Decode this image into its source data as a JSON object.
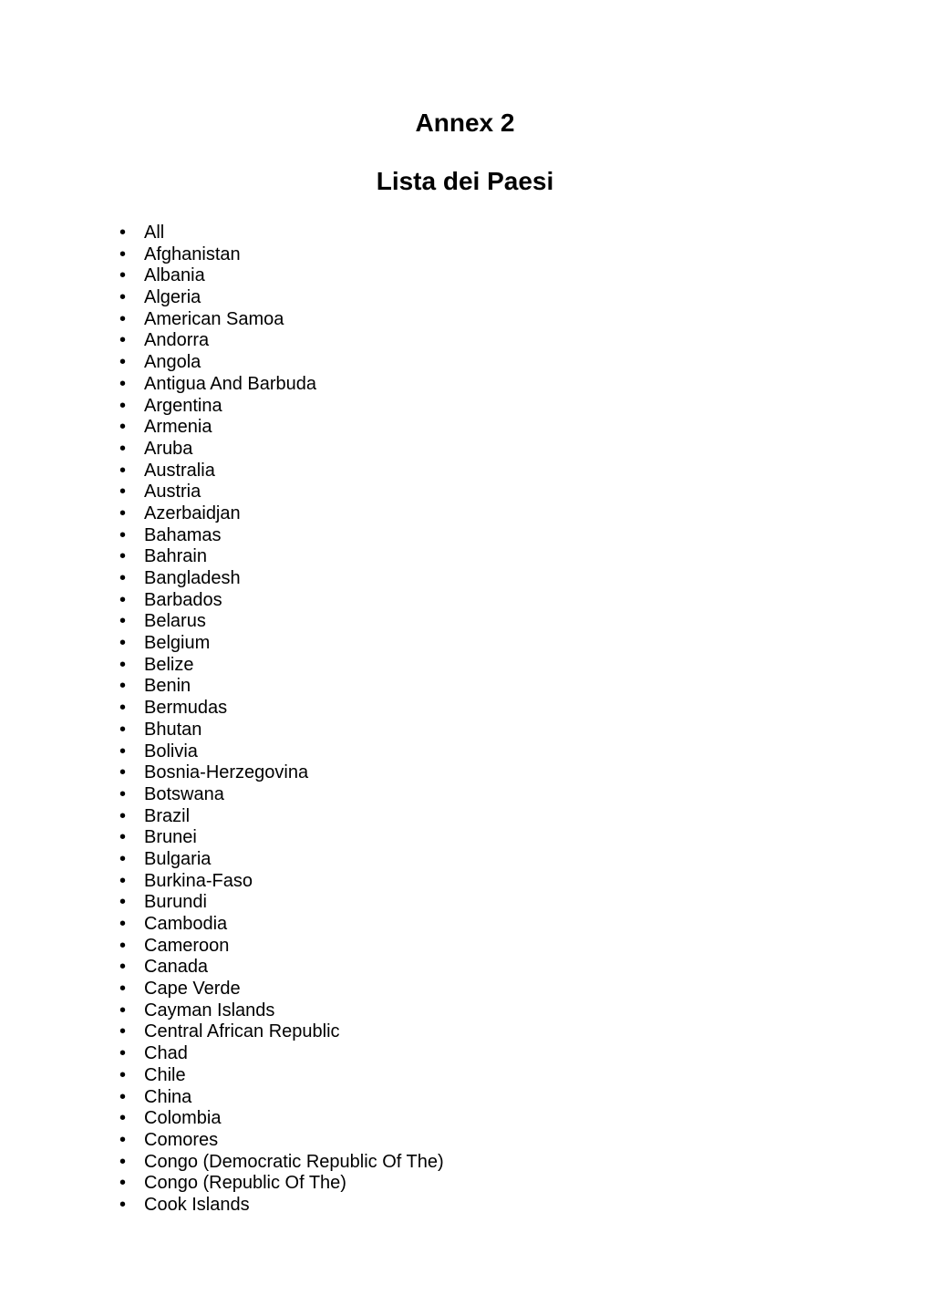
{
  "document": {
    "title": "Annex 2",
    "subtitle": "Lista dei Paesi",
    "bullet_glyph": "•",
    "text_color": "#000000",
    "background_color": "#ffffff"
  },
  "country_list": [
    "All",
    "Afghanistan",
    "Albania",
    "Algeria",
    "American Samoa",
    "Andorra",
    "Angola",
    "Antigua And Barbuda",
    "Argentina",
    "Armenia",
    "Aruba",
    "Australia",
    "Austria",
    "Azerbaidjan",
    "Bahamas",
    "Bahrain",
    "Bangladesh",
    "Barbados",
    "Belarus",
    "Belgium",
    "Belize",
    "Benin",
    "Bermudas",
    "Bhutan",
    "Bolivia",
    "Bosnia-Herzegovina",
    "Botswana",
    "Brazil",
    "Brunei",
    "Bulgaria",
    "Burkina-Faso",
    "Burundi",
    "Cambodia",
    "Cameroon",
    "Canada",
    "Cape Verde",
    "Cayman Islands",
    "Central African Republic",
    "Chad",
    "Chile",
    "China",
    "Colombia",
    "Comores",
    "Congo (Democratic Republic Of The)",
    "Congo (Republic Of The)",
    "Cook Islands"
  ]
}
